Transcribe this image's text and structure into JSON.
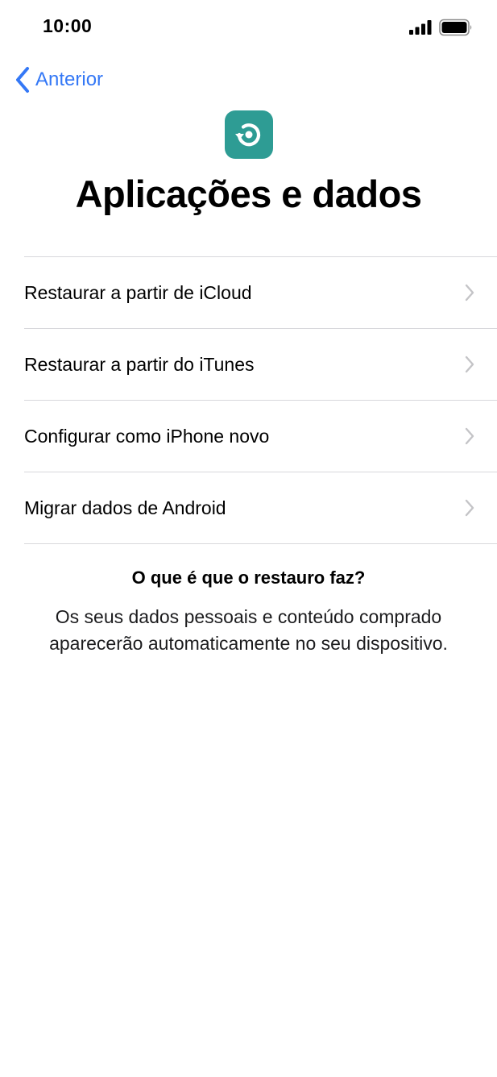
{
  "status_bar": {
    "time": "10:00",
    "signal_icon": "cellular-signal-icon",
    "battery_icon": "battery-full-icon"
  },
  "nav": {
    "back_label": "Anterior",
    "back_icon": "chevron-left-icon"
  },
  "header": {
    "app_icon": "restore-icon",
    "title": "Aplicações e dados"
  },
  "options": [
    {
      "label": "Restaurar a partir de iCloud"
    },
    {
      "label": "Restaurar a partir do iTunes"
    },
    {
      "label": "Configurar como iPhone novo"
    },
    {
      "label": "Migrar dados de Android"
    }
  ],
  "info": {
    "heading": "O que é que o restauro faz?",
    "body_line_1": "Os seus dados pessoais e conteúdo comprado",
    "body_line_2": "aparecerão automaticamente no seu dispositivo."
  },
  "colors": {
    "accent": "#3478f6",
    "app_icon_bg": "#2e9c94",
    "separator": "#d8d8dc",
    "chevron": "#c4c4c7"
  }
}
